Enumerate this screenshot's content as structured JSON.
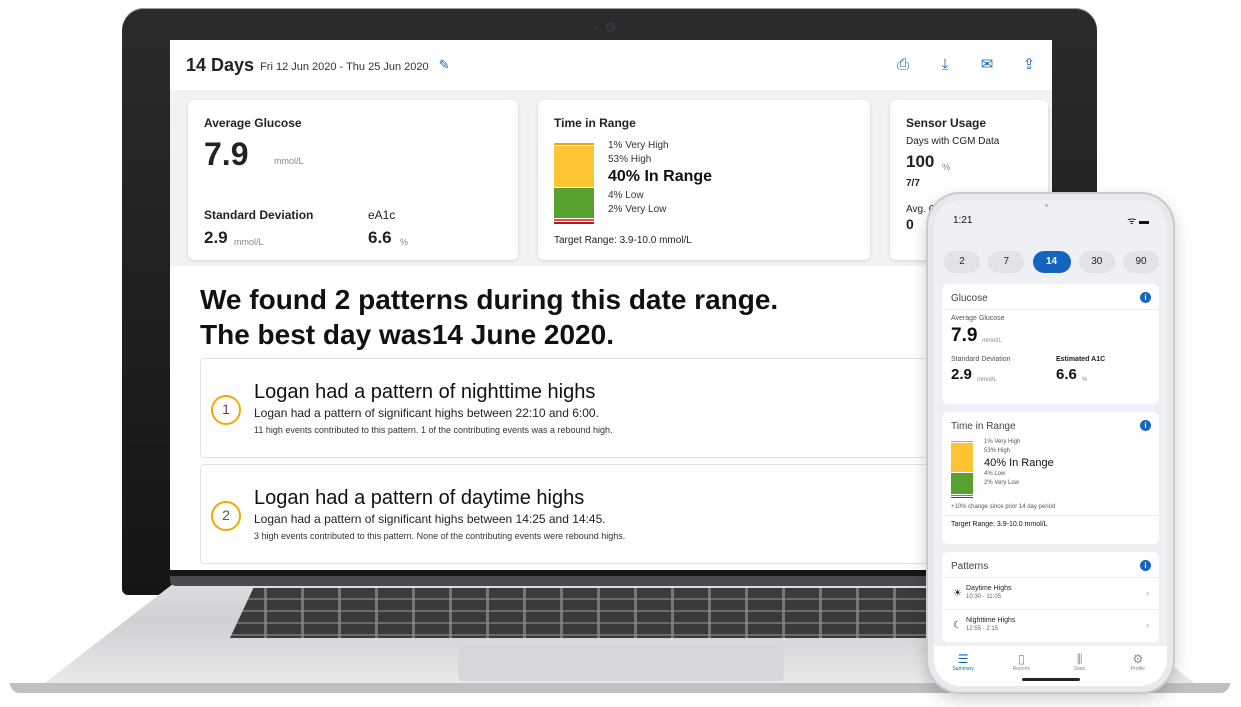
{
  "dashboard": {
    "range_days": "14 Days",
    "range_dates": "Fri 12 Jun 2020 - Thu 25 Jun 2020",
    "avg_glucose": {
      "label": "Average Glucose",
      "value": "7.9",
      "unit": "mmol/L"
    },
    "std_dev": {
      "label": "Standard Deviation",
      "value": "2.9",
      "unit": "mmol/L"
    },
    "ea1c": {
      "label": "eA1c",
      "value": "6.6",
      "unit": "%"
    },
    "tir": {
      "title": "Time in Range",
      "very_high": "1% Very High",
      "high": "53% High",
      "in_range": "40% In Range",
      "low": "4% Low",
      "very_low": "2% Very Low",
      "target": "Target Range: 3.9-10.0 mmol/L",
      "segments": [
        {
          "name": "very-high",
          "pct": 1,
          "color": "#e8a020"
        },
        {
          "name": "high",
          "pct": 53,
          "color": "#fdc533"
        },
        {
          "name": "in-range",
          "pct": 40,
          "color": "#58a130"
        },
        {
          "name": "low",
          "pct": 4,
          "color": "#e05050"
        },
        {
          "name": "very-low",
          "pct": 2,
          "color": "#b01f1f"
        }
      ]
    },
    "sensor": {
      "title": "Sensor Usage",
      "days_label": "Days with CGM Data",
      "days_value": "100",
      "days_unit": "%",
      "fraction": "7/7",
      "avg_label": "Avg. C",
      "avg_value": "0"
    },
    "patterns": {
      "headline1": "We found 2 patterns during this date range.",
      "headline2": "The best day was14 June  2020.",
      "items": [
        {
          "num": "1",
          "title": "Logan had a pattern of nighttime highs",
          "desc": "Logan had a pattern of significant highs between 22:10 and 6:00.",
          "note": "11 high events contributed to this pattern. 1 of the contributing events was a rebound high."
        },
        {
          "num": "2",
          "title": "Logan had a pattern of daytime highs",
          "desc": "Logan had a pattern of significant highs between 14:25 and 14:45.",
          "note": "3 high events contributed to this pattern. None of the contributing events were rebound highs."
        }
      ]
    }
  },
  "phone": {
    "time": "1:21",
    "periods": [
      "2",
      "7",
      "14",
      "30",
      "90"
    ],
    "active_period": "14",
    "glucose": {
      "title": "Glucose",
      "avg_label": "Average Glucose",
      "avg_value": "7.9",
      "avg_unit": "mmol/L",
      "sd_label": "Standard Deviation",
      "sd_value": "2.9",
      "sd_unit": "mmol/L",
      "a1c_label": "Estimated A1C",
      "a1c_value": "6.6",
      "a1c_unit": "%"
    },
    "tir": {
      "title": "Time in Range",
      "very_high": "1% Very High",
      "high": "53% High",
      "in_range": "40% In Range",
      "low": "4% Low",
      "very_low": "2% Very Low",
      "change": "+10% change since prior 14 day period",
      "target": "Target Range: 3.9-10.0 mmol/L"
    },
    "patterns": {
      "title": "Patterns",
      "items": [
        {
          "name": "Daytime Highs",
          "time": "10:30 - 11:05",
          "icon": "sun-icon"
        },
        {
          "name": "Nighttime Highs",
          "time": "12:55 - 2:15",
          "icon": "moon-icon"
        }
      ]
    },
    "tabs": [
      "Summary",
      "Reports",
      "Stats",
      "Profile"
    ]
  },
  "colors": {
    "accent": "#1565c0",
    "pattern_ring": "#f2a900"
  }
}
